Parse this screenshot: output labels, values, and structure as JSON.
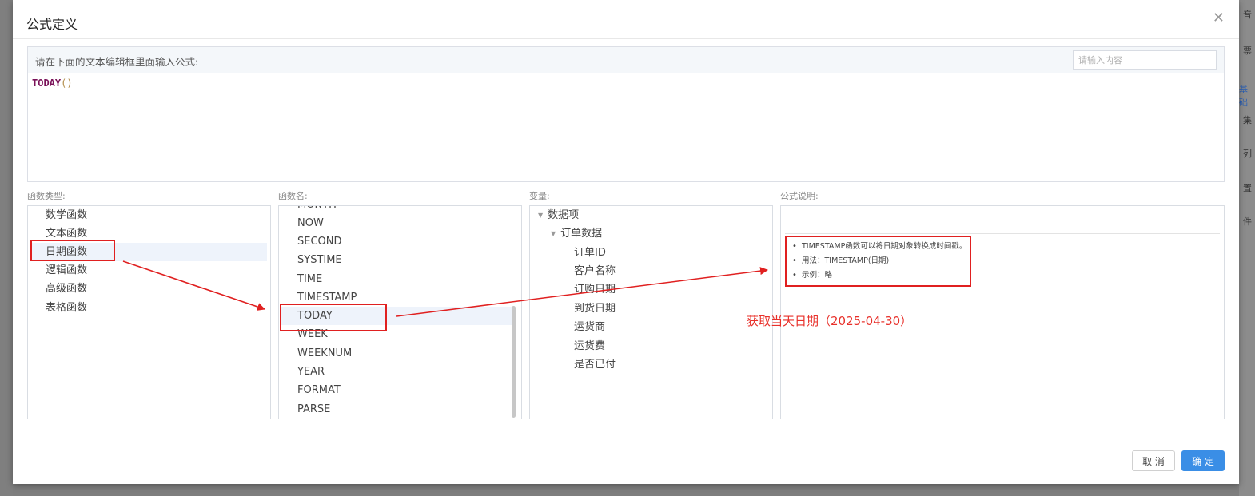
{
  "dialog": {
    "title": "公式定义",
    "close_icon": "close-icon"
  },
  "editor": {
    "hint": "请在下面的文本编辑框里面输入公式:",
    "search_placeholder": "请输入内容",
    "formula_fn": "TODAY",
    "formula_parens": "()"
  },
  "panels": {
    "category_label": "函数类型:",
    "function_label": "函数名:",
    "variable_label": "变量:",
    "description_label": "公式说明:"
  },
  "categories": [
    {
      "label": "数学函数"
    },
    {
      "label": "文本函数"
    },
    {
      "label": "日期函数",
      "selected": true
    },
    {
      "label": "逻辑函数"
    },
    {
      "label": "高级函数"
    },
    {
      "label": "表格函数"
    }
  ],
  "functions": [
    {
      "label": "MONTH"
    },
    {
      "label": "NOW"
    },
    {
      "label": "SECOND"
    },
    {
      "label": "SYSTIME"
    },
    {
      "label": "TIME"
    },
    {
      "label": "TIMESTAMP"
    },
    {
      "label": "TODAY",
      "selected": true
    },
    {
      "label": "WEEK"
    },
    {
      "label": "WEEKNUM"
    },
    {
      "label": "YEAR"
    },
    {
      "label": "FORMAT"
    },
    {
      "label": "PARSE"
    }
  ],
  "variables": {
    "root": "数据项",
    "group": "订单数据",
    "fields": [
      "订单ID",
      "客户名称",
      "订购日期",
      "到货日期",
      "运货商",
      "运货费",
      "是否已付"
    ]
  },
  "description": {
    "items": [
      "TIMESTAMP函数可以将日期对象转换成时间戳。",
      "用法：TIMESTAMP(日期)",
      "示例：略"
    ]
  },
  "annotation": "获取当天日期（2025-04-30）",
  "footer": {
    "cancel_label": "取 消",
    "ok_label": "确 定"
  },
  "background_right": [
    "音",
    "票",
    "基础",
    "集",
    "列",
    "置",
    "件"
  ],
  "colors": {
    "primary": "#3a8ee6",
    "annotation_red": "#e02020",
    "formula_fn": "#7a1259"
  }
}
